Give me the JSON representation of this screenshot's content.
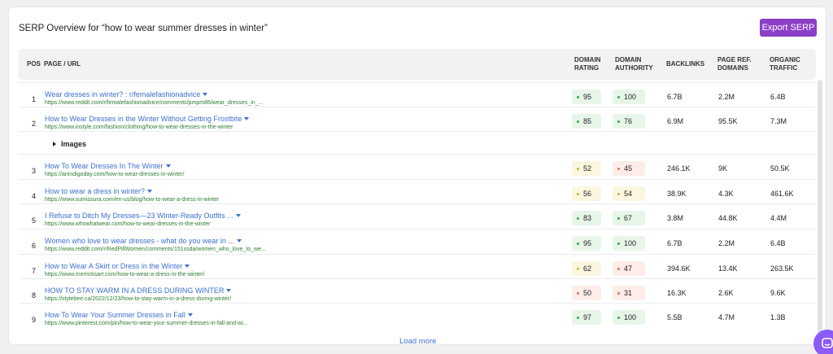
{
  "header": {
    "title": "SERP Overview for “how to wear summer dresses in winter”",
    "export_label": "Export SERP"
  },
  "columns": {
    "pos": "POS",
    "page": "PAGE / URL",
    "domain_rating": [
      "DOMAIN",
      "RATING"
    ],
    "domain_authority": [
      "DOMAIN",
      "AUTHORITY"
    ],
    "backlinks": "BACKLINKS",
    "page_ref_domains": [
      "PAGE REF.",
      "DOMAINS"
    ],
    "organic_traffic": [
      "ORGANIC",
      "TRAFFIC"
    ]
  },
  "rows": [
    {
      "pos": "1",
      "title": "Wear dresses in winter? : r/femalefashionadvice",
      "url": "https://www.reddit.com/r/femalefashionadvice/comments/pmpm86/wear_dresses_in_...",
      "dr": "95",
      "dr_level": "good",
      "da": "100",
      "da_level": "good",
      "backlinks": "6.7B",
      "ref_domains": "2.2M",
      "traffic": "6.4B"
    },
    {
      "pos": "2",
      "title": "How to Wear Dresses in the Winter Without Getting Frostbite",
      "url": "https://www.instyle.com/fashion/clothing/how-to-wear-dresses-in-the-winter",
      "dr": "85",
      "dr_level": "good",
      "da": "76",
      "da_level": "good",
      "backlinks": "6.9M",
      "ref_domains": "95.5K",
      "traffic": "7.3M"
    },
    {
      "pos": "3",
      "title": "How To Wear Dresses In The Winter",
      "url": "https://anindigoday.com/how-to-wear-dresses-in-winter/",
      "dr": "52",
      "dr_level": "mid",
      "da": "45",
      "da_level": "bad",
      "backlinks": "246.1K",
      "ref_domains": "9K",
      "traffic": "50.5K"
    },
    {
      "pos": "4",
      "title": "How to wear a dress in winter?",
      "url": "https://www.sumissura.com/en-us/blog/how-to-wear-a-dress-in-winter",
      "dr": "56",
      "dr_level": "mid",
      "da": "54",
      "da_level": "mid",
      "backlinks": "38.9K",
      "ref_domains": "4.3K",
      "traffic": "461.6K"
    },
    {
      "pos": "5",
      "title": "I Refuse to Ditch My Dresses—23 Winter-Ready Outfits ...",
      "url": "https://www.whowhatwear.com/how-to-wear-dresses-in-the-winter",
      "dr": "83",
      "dr_level": "good",
      "da": "67",
      "da_level": "good",
      "backlinks": "3.8M",
      "ref_domains": "44.8K",
      "traffic": "4.4M"
    },
    {
      "pos": "6",
      "title": "Women who love to wear dresses - what do you wear in ...",
      "url": "https://www.reddit.com/r/RedPillWomen/comments/151ssda/women_who_love_to_we...",
      "dr": "95",
      "dr_level": "good",
      "da": "100",
      "da_level": "good",
      "backlinks": "6.7B",
      "ref_domains": "2.2M",
      "traffic": "6.4B"
    },
    {
      "pos": "7",
      "title": "How to Wear A Skirt or Dress in the Winter",
      "url": "https://www.merricksart.com/how-to-wear-a-dress-in-the-winter/",
      "dr": "62",
      "dr_level": "mid",
      "da": "47",
      "da_level": "bad",
      "backlinks": "394.6K",
      "ref_domains": "13.4K",
      "traffic": "263.5K"
    },
    {
      "pos": "8",
      "title": "HOW TO STAY WARM IN A DRESS DURING WINTER",
      "url": "https://stylebee.ca/2022/12/23/how-to-stay-warm-in-a-dress-during-winter/",
      "dr": "50",
      "dr_level": "bad",
      "da": "31",
      "da_level": "bad",
      "backlinks": "16.3K",
      "ref_domains": "2.6K",
      "traffic": "9.6K"
    },
    {
      "pos": "9",
      "title": "How To Wear Your Summer Dresses in Fall",
      "url": "https://www.pinterest.com/pin/how-to-wear-your-summer-dresses-in-fall-and-wi...",
      "dr": "97",
      "dr_level": "good",
      "da": "100",
      "da_level": "good",
      "backlinks": "5.5B",
      "ref_domains": "4.7M",
      "traffic": "1.3B"
    }
  ],
  "images_row": {
    "label": "Images"
  },
  "footer": {
    "load_more": "Load more"
  },
  "colors": {
    "accent": "#8b3fc7",
    "link": "#3c6fd0",
    "url": "#2e7d32",
    "chat": "#8b5cf6"
  }
}
